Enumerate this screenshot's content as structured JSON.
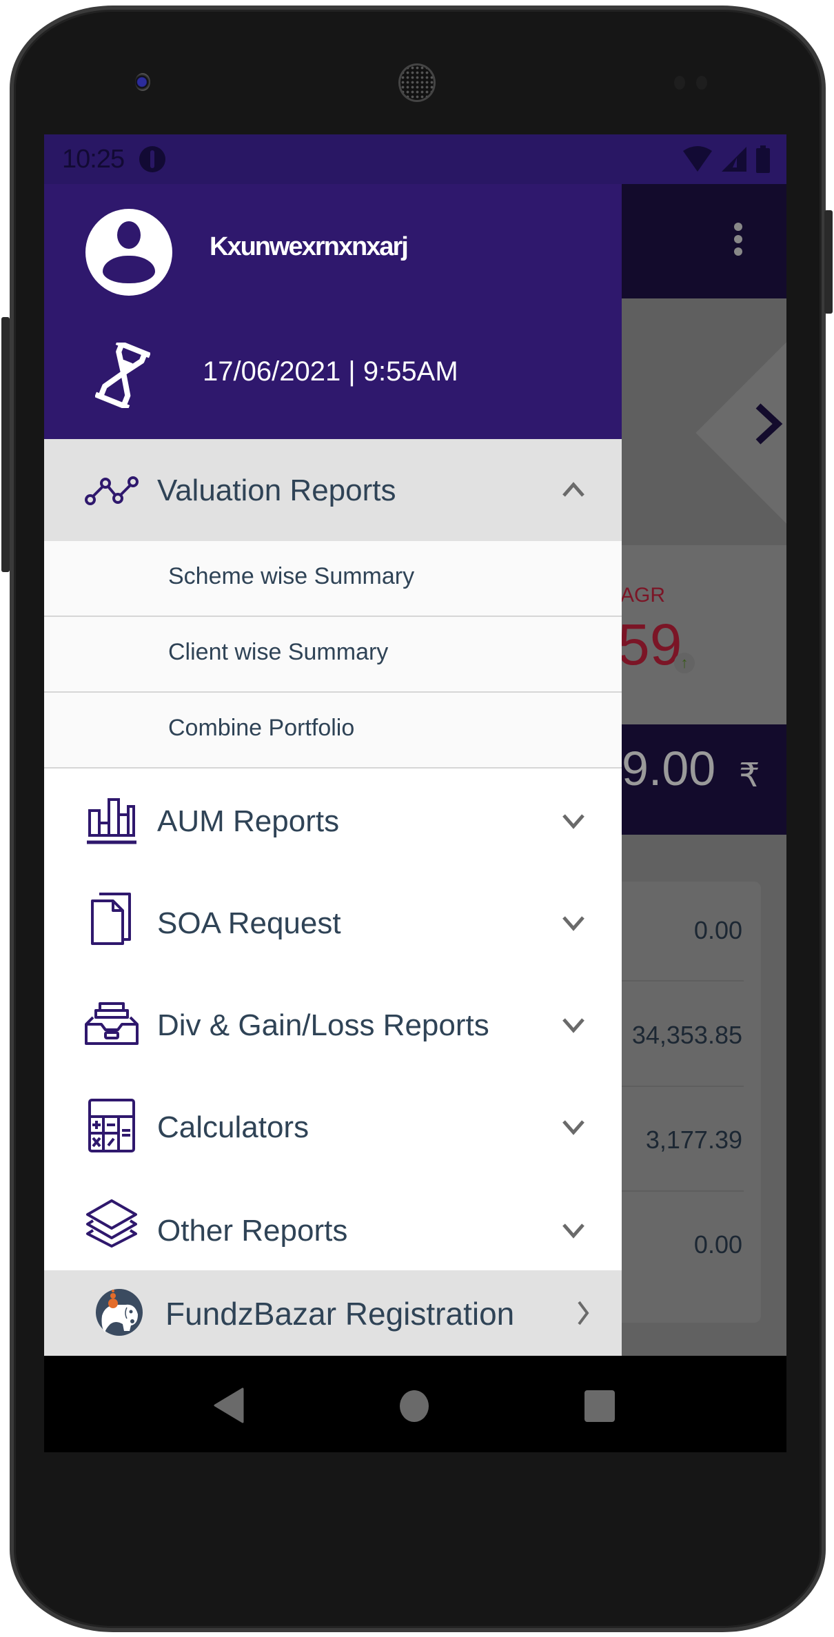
{
  "status_bar": {
    "time": "10:25",
    "icons": [
      "app-notification-icon",
      "wifi-icon",
      "cellular-signal-icon",
      "battery-icon"
    ]
  },
  "drawer": {
    "header": {
      "user_name": "Kxunwexrnxnxarj",
      "last_login": "17/06/2021 | 9:55AM",
      "avatar_icon": "account-circle-icon",
      "login_time_icon": "hourglass-icon"
    },
    "menu": [
      {
        "label": "Valuation Reports",
        "icon": "line-graph-icon",
        "expanded": true,
        "children": [
          {
            "label": "Scheme wise Summary"
          },
          {
            "label": "Client wise Summary"
          },
          {
            "label": "Combine Portfolio"
          }
        ]
      },
      {
        "label": "AUM Reports",
        "icon": "bar-chart-icon",
        "expanded": false
      },
      {
        "label": "SOA Request",
        "icon": "documents-icon",
        "expanded": false
      },
      {
        "label": "Div & Gain/Loss Reports",
        "icon": "archive-drawer-icon",
        "expanded": false
      },
      {
        "label": "Calculators",
        "icon": "calculator-icon",
        "expanded": false
      },
      {
        "label": "Other Reports",
        "icon": "layers-icon",
        "expanded": false
      }
    ],
    "footer": {
      "label": "FundzBazar Registration",
      "icon": "fundzbazar-logo-icon"
    }
  },
  "background_app": {
    "overflow_icon": "more-vert-icon",
    "next_icon": "chevron-right-icon",
    "cagr_label": "AGR",
    "cagr_value": "59",
    "cagr_trend": "up",
    "total_value": "9.00",
    "currency_symbol": "₹",
    "rows": [
      "0.00",
      "34,353.85",
      "3,177.39",
      "0.00"
    ]
  },
  "nav_bar": {
    "buttons": [
      "back",
      "home",
      "recents"
    ]
  },
  "colors": {
    "primary": "#2f186d",
    "status_bar": "#291764",
    "text": "#2f4356",
    "icon_accent": "#2f186d",
    "expanded_bg": "#e1e1e1",
    "cagr_red": "#7b1526",
    "fundz_orange": "#e36c2a",
    "fundz_navy": "#3b4b60"
  }
}
